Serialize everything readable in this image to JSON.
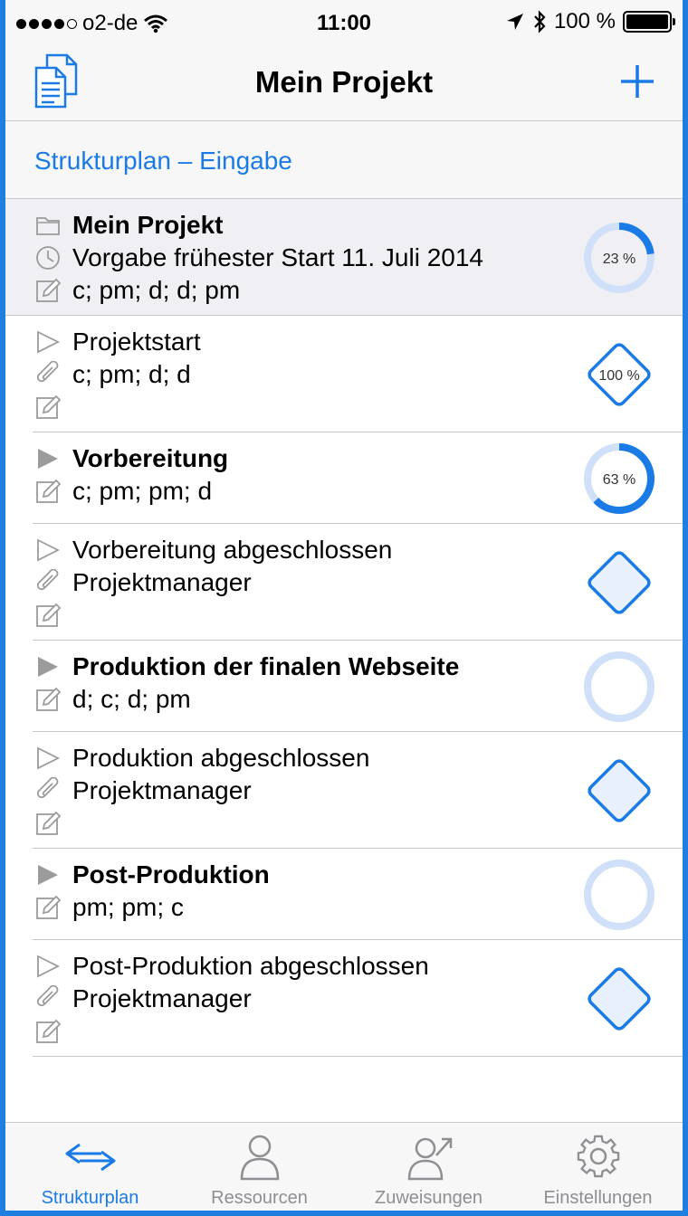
{
  "status_bar": {
    "carrier": "o2-de",
    "time": "11:00",
    "battery_text": "100 %"
  },
  "navbar": {
    "title": "Mein Projekt",
    "left_icon": "documents-icon",
    "right_icon": "plus-icon"
  },
  "section": {
    "breadcrumb_a": "Strukturplan",
    "breadcrumb_sep": " – ",
    "breadcrumb_b": "Eingabe"
  },
  "rows": [
    {
      "kind": "project",
      "name": "Mein Projekt",
      "start_label": "Vorgabe frühester Start",
      "start_date": "11. Juli 2014",
      "resources": "c; pm; d; d; pm",
      "progress": 0.23,
      "progress_label": "23 %"
    },
    {
      "kind": "milestone",
      "name": "Projektstart",
      "attachment": "c; pm; d; d",
      "progress": 1.0,
      "progress_label": "100 %"
    },
    {
      "kind": "group",
      "name": "Vorbereitung",
      "resources": "c; pm; pm; d",
      "progress": 0.63,
      "progress_label": "63 %"
    },
    {
      "kind": "milestone",
      "name": "Vorbereitung abgeschlossen",
      "attachment": "Projektmanager",
      "progress": 0,
      "progress_label": ""
    },
    {
      "kind": "group",
      "name": "Produktion der finalen Webseite",
      "resources": "d; c; d; pm",
      "progress": 0,
      "progress_label": ""
    },
    {
      "kind": "milestone",
      "name": "Produktion abgeschlossen",
      "attachment": "Projektmanager",
      "progress": 0,
      "progress_label": ""
    },
    {
      "kind": "group",
      "name": "Post-Produktion",
      "resources": "pm; pm; c",
      "progress": 0,
      "progress_label": ""
    },
    {
      "kind": "milestone",
      "name": "Post-Produktion abgeschlossen",
      "attachment": "Projektmanager",
      "progress": 0,
      "progress_label": ""
    }
  ],
  "tabbar": {
    "tabs": [
      {
        "label": "Strukturplan",
        "icon": "arrows-icon",
        "active": true
      },
      {
        "label": "Ressourcen",
        "icon": "person-icon",
        "active": false
      },
      {
        "label": "Zuweisungen",
        "icon": "person-arrow-icon",
        "active": false
      },
      {
        "label": "Einstellungen",
        "icon": "gear-icon",
        "active": false
      }
    ]
  },
  "colors": {
    "accent": "#1a7be6",
    "ring_bg": "#cfe0f8",
    "diamond_fill": "#e8f0fb",
    "gray_icon": "#9b9b9b"
  }
}
